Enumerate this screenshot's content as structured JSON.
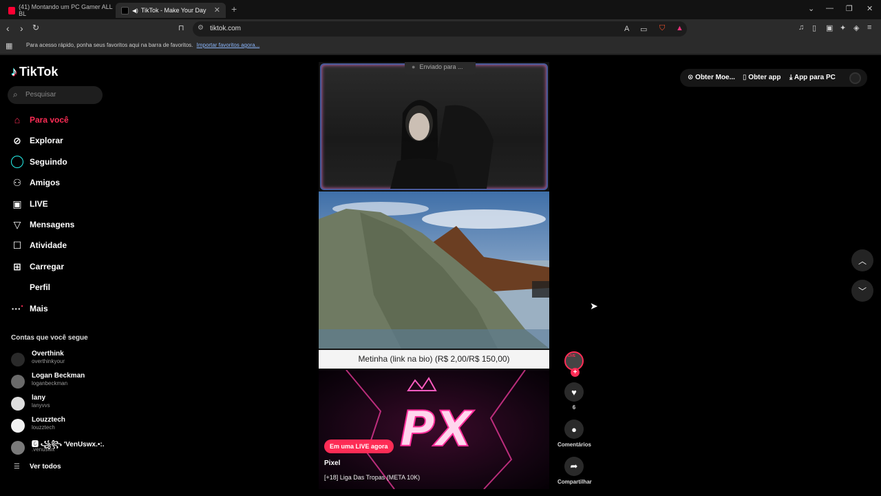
{
  "browser": {
    "tabs": [
      {
        "title": "(41) Montando um PC Gamer ALL BL",
        "active": false
      },
      {
        "title": "TikTok - Make Your Day",
        "active": true
      }
    ],
    "url": "tiktok.com",
    "bookmarks_hint": "Para acesso rápido, ponha seus favoritos aqui na barra de favoritos.",
    "bookmarks_link": "Importar favoritos agora..."
  },
  "sidebar": {
    "logo": "TikTok",
    "search_placeholder": "Pesquisar",
    "nav": [
      {
        "label": "Para você",
        "icon": "home-icon",
        "active": true
      },
      {
        "label": "Explorar",
        "icon": "compass-icon"
      },
      {
        "label": "Seguindo",
        "icon": "following-icon"
      },
      {
        "label": "Amigos",
        "icon": "friends-icon"
      },
      {
        "label": "LIVE",
        "icon": "live-icon"
      },
      {
        "label": "Mensagens",
        "icon": "messages-icon"
      },
      {
        "label": "Atividade",
        "icon": "activity-icon"
      },
      {
        "label": "Carregar",
        "icon": "upload-icon"
      },
      {
        "label": "Perfil",
        "icon": "profile-icon"
      },
      {
        "label": "Mais",
        "icon": "more-icon"
      }
    ],
    "following_title": "Contas que você segue",
    "accounts": [
      {
        "name": "Overthink",
        "handle": "overthinkyour"
      },
      {
        "name": "Logan Beckman",
        "handle": "loganbeckman"
      },
      {
        "name": "lany",
        "handle": "lanyvvs"
      },
      {
        "name": "Louzztech",
        "handle": "louzztech"
      },
      {
        "name": "🅶 ꧁꧂ 'VenUswx.•:.",
        "handle": ".venuswx"
      }
    ],
    "see_all": "Ver todos"
  },
  "video": {
    "toast": "Enviado para ...",
    "goal": "Metinha (link na bio) (R$ 2,00/R$ 150,00)",
    "live_badge": "Em uma LIVE agora",
    "author": "Pixel",
    "caption": "[+18] Liga Das Tropas (META 10K)",
    "banner_text": "PX"
  },
  "actions": {
    "live_label": "LIVE",
    "likes": "6",
    "comments_label": "Comentários",
    "share_label": "Compartilhar"
  },
  "topbar": {
    "coins": "Obter Moe...",
    "get_app": "Obter app",
    "pc_app": "App para PC"
  }
}
